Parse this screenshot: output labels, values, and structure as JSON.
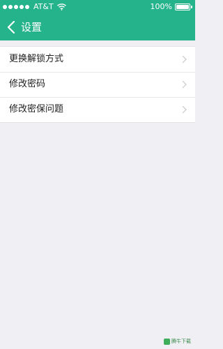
{
  "status_bar": {
    "carrier": "AT&T",
    "battery": "100%",
    "icons": [
      "signal-dots",
      "wifi-icon",
      "battery-icon"
    ]
  },
  "nav": {
    "back_icon": "chevron-left-icon",
    "title": "设置"
  },
  "menu": {
    "items": [
      {
        "label": "更换解锁方式",
        "icon": "chevron-right-icon"
      },
      {
        "label": "修改密码",
        "icon": "chevron-right-icon"
      },
      {
        "label": "修改密保问题",
        "icon": "chevron-right-icon"
      }
    ]
  },
  "watermark": {
    "text": "腾牛下载"
  },
  "colors": {
    "accent": "#25b38b",
    "background": "#efeff4",
    "text": "#222222",
    "chevron": "#c7c7cc"
  }
}
